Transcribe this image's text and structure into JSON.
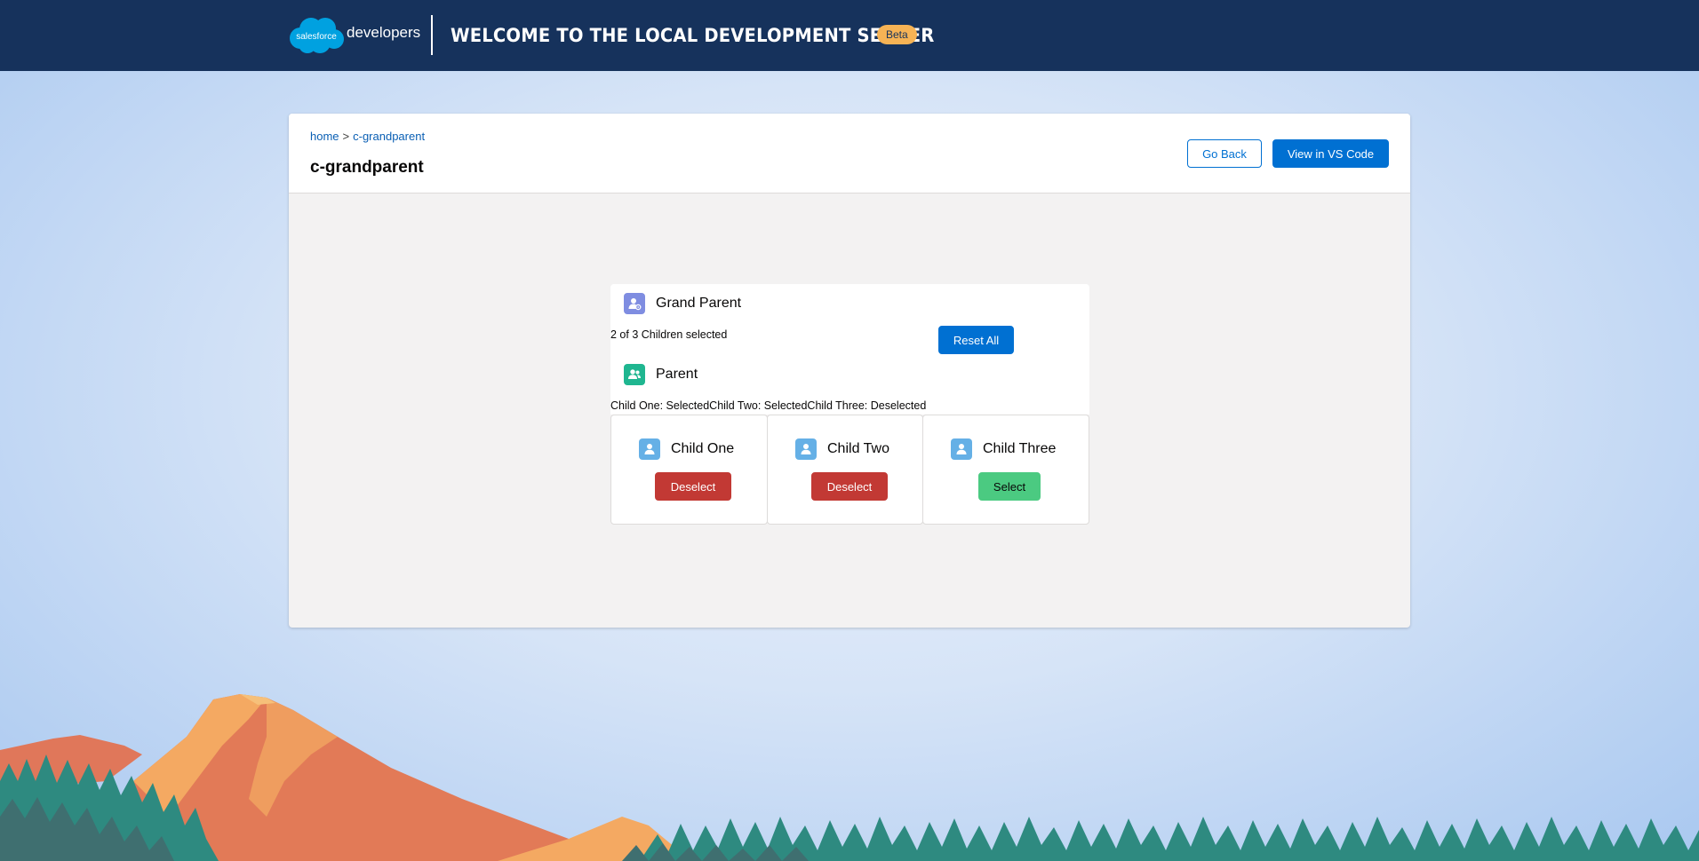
{
  "header": {
    "logo_cloud_text": "salesforce",
    "logo_word": "developers",
    "title": "Welcome to the Local Development Server",
    "badge": "Beta"
  },
  "page": {
    "breadcrumb": {
      "home": "home",
      "separator": ">",
      "current": "c-grandparent"
    },
    "title": "c-grandparent",
    "go_back_label": "Go Back",
    "view_code_label": "View in VS Code"
  },
  "component": {
    "grandparent": {
      "label": "Grand Parent",
      "icon": "user-gear-icon",
      "status": "2 of 3 Children selected",
      "reset_label": "Reset All"
    },
    "parent": {
      "label": "Parent",
      "icon": "users-icon",
      "status": "Child One: SelectedChild Two: SelectedChild Three: Deselected"
    },
    "children": [
      {
        "label": "Child One",
        "icon": "user-icon",
        "button": "Deselect",
        "selected": true
      },
      {
        "label": "Child Two",
        "icon": "user-icon",
        "button": "Deselect",
        "selected": true
      },
      {
        "label": "Child Three",
        "icon": "user-icon",
        "button": "Select",
        "selected": false
      }
    ]
  },
  "colors": {
    "header_bg": "#16325c",
    "brand": "#0070d2",
    "badge": "#f6b355",
    "destructive": "#c23934",
    "success": "#4bca81",
    "grandparent_icon": "#7f8de1",
    "parent_icon": "#1fb690",
    "child_icon": "#65b0e6"
  }
}
